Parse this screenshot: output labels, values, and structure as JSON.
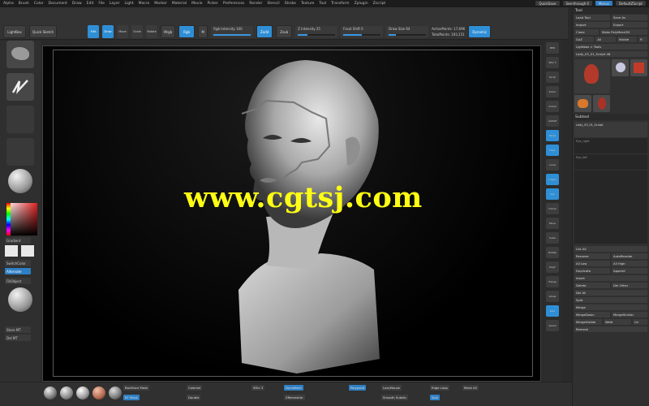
{
  "menu": [
    "Alpha",
    "Brush",
    "Color",
    "Document",
    "Draw",
    "Edit",
    "File",
    "Layer",
    "Light",
    "Macro",
    "Marker",
    "Material",
    "Movie",
    "Picker",
    "Preferences",
    "Render",
    "Stencil",
    "Stroke",
    "Texture",
    "Tool",
    "Transform",
    "Zplugin",
    "Zscript"
  ],
  "menu_right": {
    "quicksave": "QuickSave",
    "seethrough": "See-through 0",
    "menus": "Menus",
    "default": "DefaultZScript"
  },
  "topbar": {
    "lightbox": "LightBox",
    "quick": "Quick Sketch",
    "edit": "Edit",
    "draw": "Draw",
    "move": "Move",
    "scale": "Scale",
    "rotate": "Rotate",
    "mrgb": "Mrgb",
    "rgb": "Rgb",
    "m": "M",
    "zadd": "Zadd",
    "zsub": "Zsub",
    "zcut": "Zcut",
    "focal": "Focal Shift 0",
    "draw_size": "Draw Size 64",
    "rgb_intensity": "Rgb Intensity 100",
    "z_intensity": "Z Intensity 25",
    "active_points": "ActivePoints: 17,696",
    "total_points": "TotalPoints: 193,151",
    "dynamic": "Dynamic"
  },
  "left_panel": {
    "labels": [
      "Standard",
      "Freehand",
      "Alpha Off",
      "Texture Off",
      "BasicMaterial"
    ],
    "gradient": "Gradient",
    "switch_color": "SwitchColor",
    "alternate": "Alternate",
    "fill_object": "FillObject",
    "buttons": [
      "Store MT",
      "Del MT"
    ]
  },
  "watermark": "www.cgtsj.com",
  "right_tools": [
    "BPR",
    "SPix 3",
    "Scroll",
    "Zoom",
    "Actual",
    "AAHalf",
    "Persp",
    "Floor",
    "Local",
    "L.Sym",
    "Xyz",
    "Frame",
    "Move",
    "Scale",
    "Rotate",
    "PolyF",
    "Transp",
    "Ghost",
    "Solo",
    "Xpose"
  ],
  "tool_panel": {
    "title": "Tool",
    "load_tool": "Load Tool",
    "save_as": "Save As",
    "import": "Import",
    "export": "Export",
    "clone": "Clone",
    "make_polymesh": "Make PolyMesh3D",
    "goz": "GoZ",
    "all": "All",
    "visible": "Visible",
    "r": "R",
    "lightbox_tools": "Lightbox > Tools",
    "current_tool": "Lady_03_01_Sculpt 48",
    "thumb_labels": [
      "Lady_03",
      "Cylinder3D",
      "PolyMesh3D",
      "SimpleBrush",
      "Lady_03_sculpt"
    ],
    "subtool": "Subtool",
    "subtool_items": [
      "Lady_03_01_Sculpt",
      "Eye_right",
      "Eye_left"
    ],
    "list_all": "List All",
    "rename": "Rename",
    "auto_reorder": "AutoReorder",
    "all_low": "All Low",
    "all_high": "All High",
    "duplicate": "Duplicate",
    "append": "Append",
    "insert": "Insert",
    "delete": "Delete",
    "del_other": "Del Other",
    "del_all": "Del All",
    "split": "Split",
    "merge": "Merge",
    "merge_down": "MergeDown",
    "merge_similar": "MergeSimilar",
    "merge_visible": "MergeVisible",
    "weld": "Weld",
    "uv": "Uv",
    "remesh": "Remesh"
  },
  "bottom": {
    "backface": "Backface Mask",
    "bf_mask": "BF Mask",
    "colorize": "Colorize",
    "double": "Double",
    "sdiv": "SDiv 3",
    "dyna": "DynaMesh",
    "zrem": "ZRemesher",
    "polypaint": "Polypaint",
    "lazy": "LazyMouse",
    "subdiv": "Smooth Subdiv",
    "edge": "Edge Loop",
    "spin": "Spin",
    "mask": "Mask All"
  },
  "colors": {
    "accent": "#2f8fd6",
    "watermark": "#ffff14"
  }
}
